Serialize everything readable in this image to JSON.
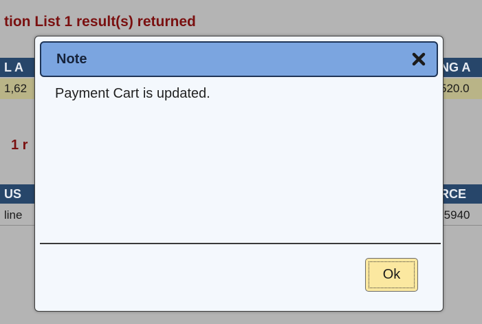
{
  "background": {
    "title": "tion List 1 result(s) returned",
    "table1": {
      "header_left": "L A",
      "header_right": "NG A",
      "value_left": "1,62",
      "value_right": "520.0"
    },
    "subtitle": "1 r",
    "table2": {
      "header_left": "US",
      "header_right": "RCE",
      "value_left": "line",
      "value_right": "-5940"
    }
  },
  "dialog": {
    "title": "Note",
    "close_icon": "close-icon",
    "message": "Payment Cart is updated.",
    "ok_label": "Ok"
  },
  "colors": {
    "titlebar": "#7ba5e0",
    "ok_button": "#fbe8a0",
    "header_row": "#27466a",
    "title_text": "#7a1010"
  }
}
